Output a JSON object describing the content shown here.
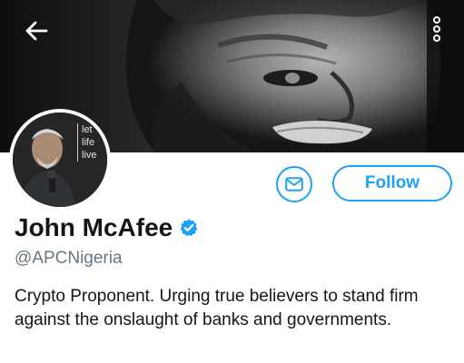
{
  "banner": {
    "back_icon": "arrow-left-icon",
    "more_icon": "vertical-ellipsis-icon"
  },
  "avatar": {
    "caption_lines": [
      "let",
      "life",
      "live"
    ]
  },
  "actions": {
    "message_icon": "envelope-icon",
    "follow_label": "Follow",
    "accent_color": "#1da1f2"
  },
  "profile": {
    "name": "John McAfee",
    "verified_icon": "verified-badge-icon",
    "handle": "@APCNigeria",
    "bio": "Crypto Proponent. Urging true believers to stand firm against the onslaught of banks and governments."
  }
}
